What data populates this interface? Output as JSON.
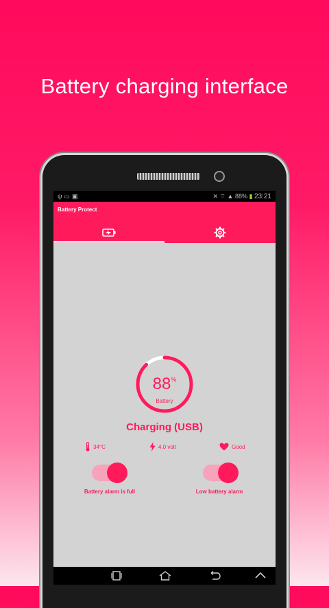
{
  "headline": "Battery charging interface",
  "status_bar": {
    "left_icons": [
      "usb-icon",
      "battery-saver-icon",
      "image-icon"
    ],
    "right_icons": [
      "silent-icon",
      "wifi-icon",
      "signal-icon",
      "battery-icon"
    ],
    "battery_percent": "88%",
    "time": "23:21"
  },
  "app": {
    "title": "Battery Protect",
    "tabs": [
      {
        "id": "battery",
        "icon": "battery-charging-icon",
        "selected": true
      },
      {
        "id": "settings",
        "icon": "gear-icon",
        "selected": false
      }
    ]
  },
  "gauge": {
    "value": "88",
    "unit": "%",
    "label": "Battery",
    "level_fraction": 0.88
  },
  "charging_status": "Charging (USB)",
  "stats": {
    "temperature": "34°C",
    "voltage": "4.0 volt",
    "health": "Good"
  },
  "toggles": [
    {
      "label": "Battery alarm is full",
      "on": true
    },
    {
      "label": "Low battery alarm",
      "on": true
    }
  ],
  "nav_icons": [
    "recent-apps-icon",
    "home-icon",
    "back-icon",
    "up-icon"
  ],
  "colors": {
    "accent": "#ff1a5c",
    "screen_bg": "#d3d3d3",
    "toggle_track": "#f6a3bb"
  }
}
